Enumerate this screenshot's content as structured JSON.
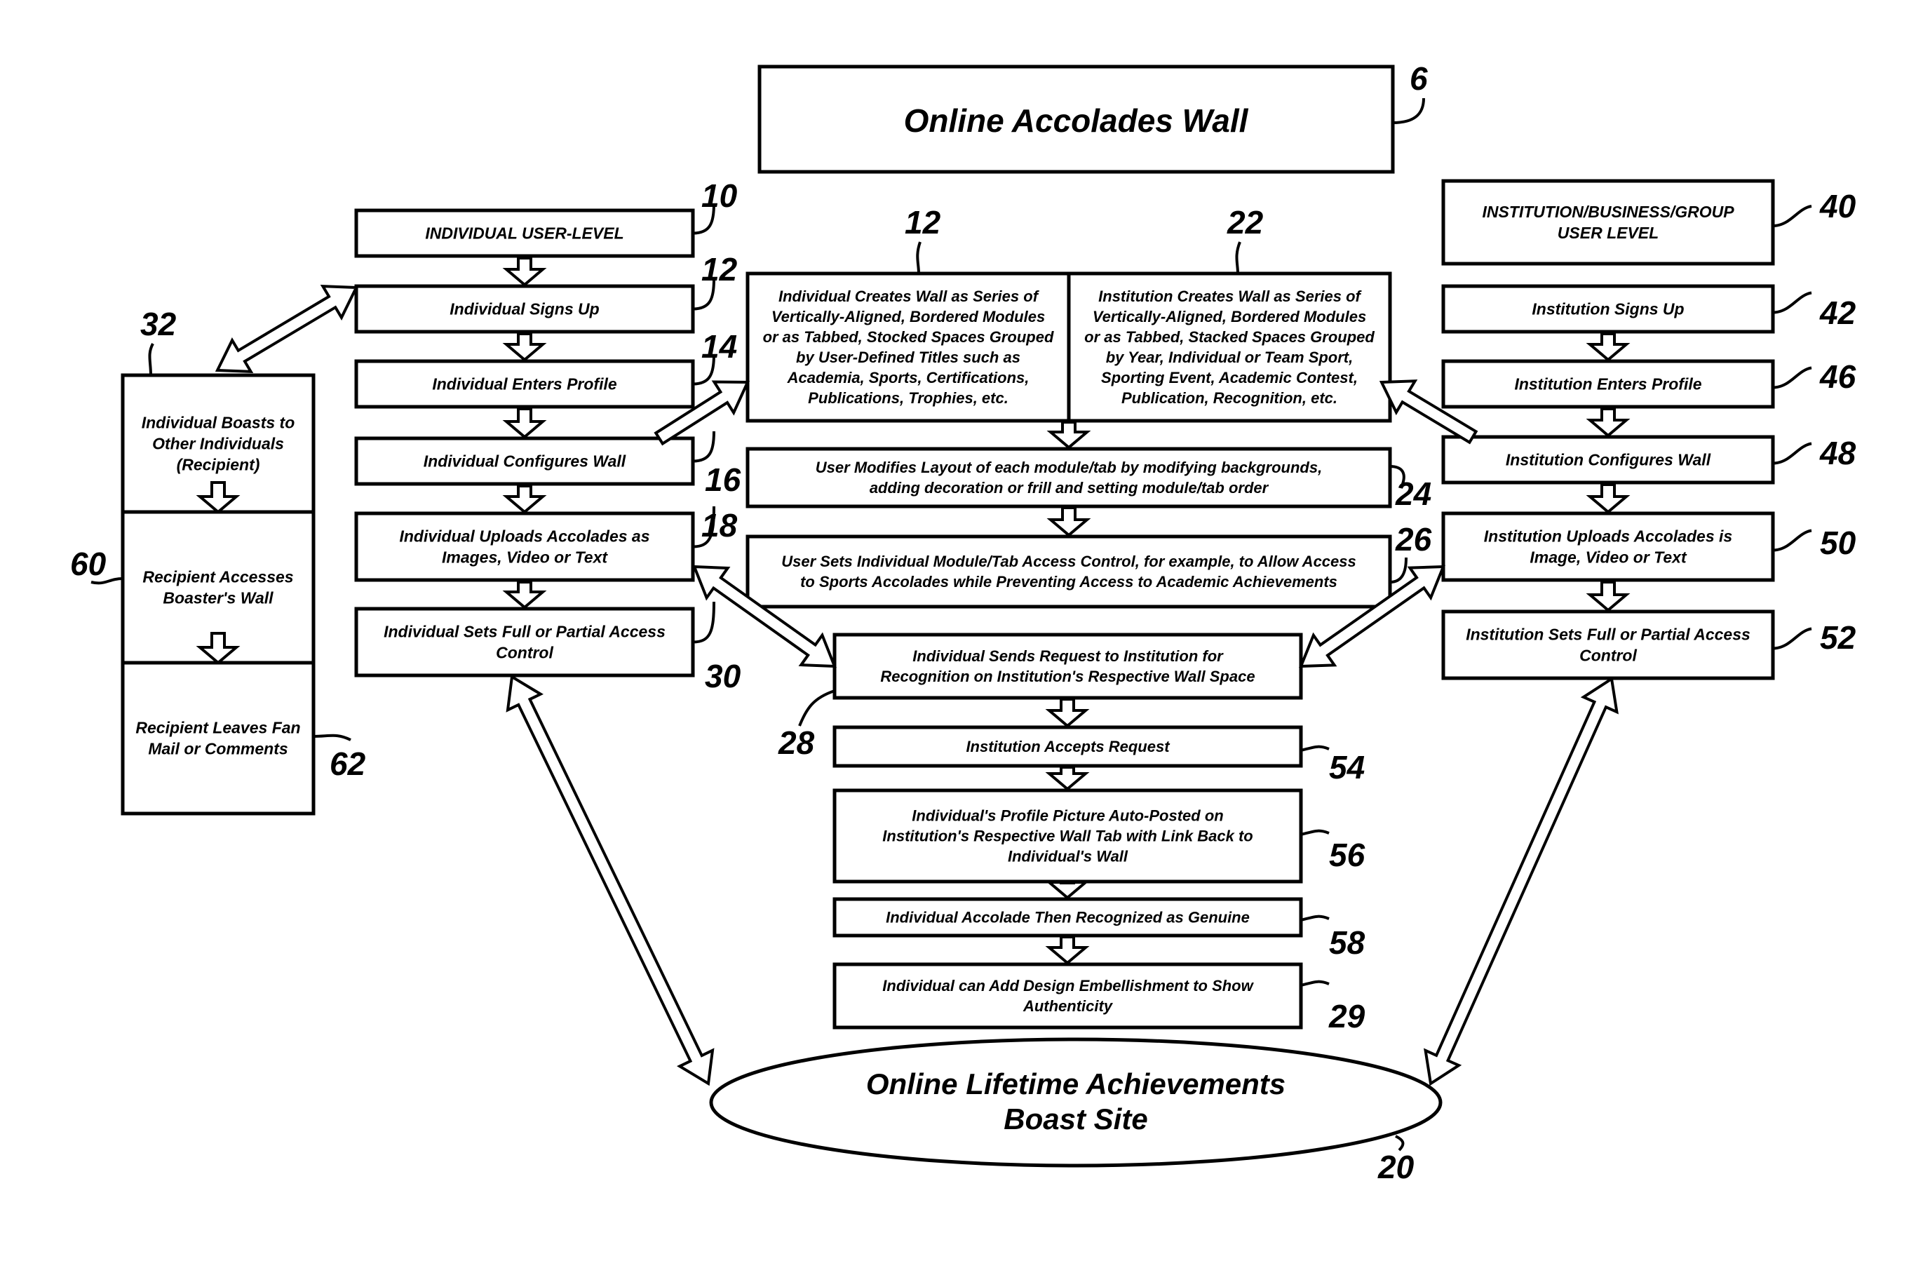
{
  "title": {
    "text": "Online Accolades Wall",
    "ref": "6"
  },
  "hub": {
    "lines": [
      "Online Lifetime Achievements",
      "Boast Site"
    ],
    "ref": "20"
  },
  "individual_column": [
    {
      "id": "ind-level",
      "lines": [
        "INDIVIDUAL USER-LEVEL"
      ],
      "ref": "10"
    },
    {
      "id": "ind-signup",
      "lines": [
        "Individual Signs Up"
      ],
      "ref": "12"
    },
    {
      "id": "ind-profile",
      "lines": [
        "Individual Enters Profile"
      ],
      "ref": "14"
    },
    {
      "id": "ind-configure",
      "lines": [
        "Individual Configures Wall"
      ],
      "ref": "16"
    },
    {
      "id": "ind-upload",
      "lines": [
        "Individual Uploads Accolades as",
        "Images, Video or Text"
      ],
      "ref": "18"
    },
    {
      "id": "ind-access",
      "lines": [
        "Individual Sets Full or Partial Access",
        "Control"
      ],
      "ref": "30"
    }
  ],
  "boast_column": {
    "ref_top": "32",
    "sections": [
      {
        "id": "boast-others",
        "lines": [
          "Individual Boasts to",
          "Other Individuals",
          "(Recipient)"
        ],
        "ref": ""
      },
      {
        "id": "recipient-access",
        "lines": [
          "Recipient Accesses",
          "Boaster's Wall"
        ],
        "ref": "60"
      },
      {
        "id": "recipient-comments",
        "lines": [
          "Recipient Leaves Fan",
          "Mail or Comments"
        ],
        "ref": "62"
      }
    ]
  },
  "wall_creation": {
    "individual": {
      "lines": [
        "Individual Creates Wall as Series of",
        "Vertically-Aligned, Bordered Modules",
        "or as Tabbed, Stocked Spaces Grouped",
        "by User-Defined Titles such as",
        "Academia, Sports, Certifications,",
        "Publications, Trophies, etc."
      ],
      "ref": "12"
    },
    "institution": {
      "lines": [
        "Institution Creates Wall as Series of",
        "Vertically-Aligned, Bordered Modules",
        "or as Tabbed, Stacked Spaces Grouped",
        "by Year, Individual or Team Sport,",
        "Sporting Event, Academic Contest,",
        "Publication, Recognition, etc."
      ],
      "ref": "22"
    }
  },
  "center_column": [
    {
      "id": "modify-layout",
      "lines": [
        "User Modifies Layout of each module/tab by modifying backgrounds,",
        "adding decoration or frill and setting module/tab order"
      ],
      "ref": "24"
    },
    {
      "id": "module-access",
      "lines": [
        "User Sets Individual Module/Tab Access Control, for example, to Allow Access",
        "to Sports Accolades while Preventing Access to Academic Achievements"
      ],
      "ref": "26"
    },
    {
      "id": "send-request",
      "lines": [
        "Individual Sends Request to Institution for",
        "Recognition on Institution's Respective Wall Space"
      ],
      "ref": "28"
    },
    {
      "id": "accept-request",
      "lines": [
        "Institution Accepts Request"
      ],
      "ref": "54"
    },
    {
      "id": "auto-post",
      "lines": [
        "Individual's Profile Picture Auto-Posted on",
        "Institution's Respective Wall Tab with Link Back to",
        "Individual's Wall"
      ],
      "ref": "56"
    },
    {
      "id": "genuine",
      "lines": [
        "Individual Accolade Then Recognized as Genuine"
      ],
      "ref": "58"
    },
    {
      "id": "embellish",
      "lines": [
        "Individual can Add Design Embellishment to Show",
        "Authenticity"
      ],
      "ref": "29"
    }
  ],
  "institution_column": [
    {
      "id": "inst-level",
      "lines": [
        "INSTITUTION/BUSINESS/GROUP",
        "USER LEVEL"
      ],
      "ref": "40"
    },
    {
      "id": "inst-signup",
      "lines": [
        "Institution Signs Up"
      ],
      "ref": "42"
    },
    {
      "id": "inst-profile",
      "lines": [
        "Institution Enters Profile"
      ],
      "ref": "46"
    },
    {
      "id": "inst-configure",
      "lines": [
        "Institution Configures Wall"
      ],
      "ref": "48"
    },
    {
      "id": "inst-upload",
      "lines": [
        "Institution Uploads Accolades is",
        "Image, Video or Text"
      ],
      "ref": "50"
    },
    {
      "id": "inst-access",
      "lines": [
        "Institution Sets Full or Partial Access",
        "Control"
      ],
      "ref": "52"
    }
  ]
}
